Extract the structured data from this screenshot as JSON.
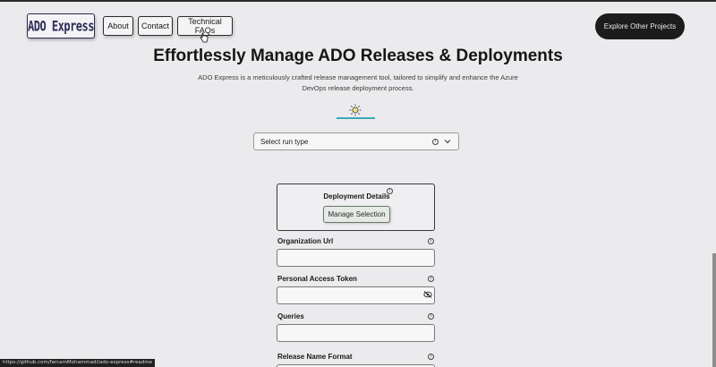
{
  "header": {
    "logo_text": "ADO Express",
    "nav": {
      "about": "About",
      "contact": "Contact",
      "faqs": "Technical FAQs"
    },
    "explore_label": "Explore Other Projects"
  },
  "hero": {
    "title": "Effortlessly Manage ADO Releases & Deployments",
    "subtitle": "ADO Express is a meticulously crafted release management tool, tailored to simplify and enhance the Azure DevOps release deployment process.",
    "theme_icon": "sun-icon"
  },
  "run_type": {
    "placeholder": "Select run type",
    "info_icon": "info-icon",
    "chevron_icon": "chevron-down-icon"
  },
  "deployment": {
    "title": "Deployment Details",
    "manage_label": "Manage Selection"
  },
  "form": {
    "org_url": {
      "label": "Organization Url",
      "value": ""
    },
    "pat": {
      "label": "Personal Access Token",
      "value": "",
      "toggle_icon": "eye-slash-icon"
    },
    "queries": {
      "label": "Queries",
      "value": ""
    },
    "release_name": {
      "label": "Release Name Format"
    }
  },
  "status_url": "https://github.com/farcamMohammadi/ado-express#readme",
  "colors": {
    "accent_line": "#3aa9b8",
    "dark_button": "#1c1c1c",
    "logo": "#2d2b55",
    "background": "#ebeaec"
  }
}
